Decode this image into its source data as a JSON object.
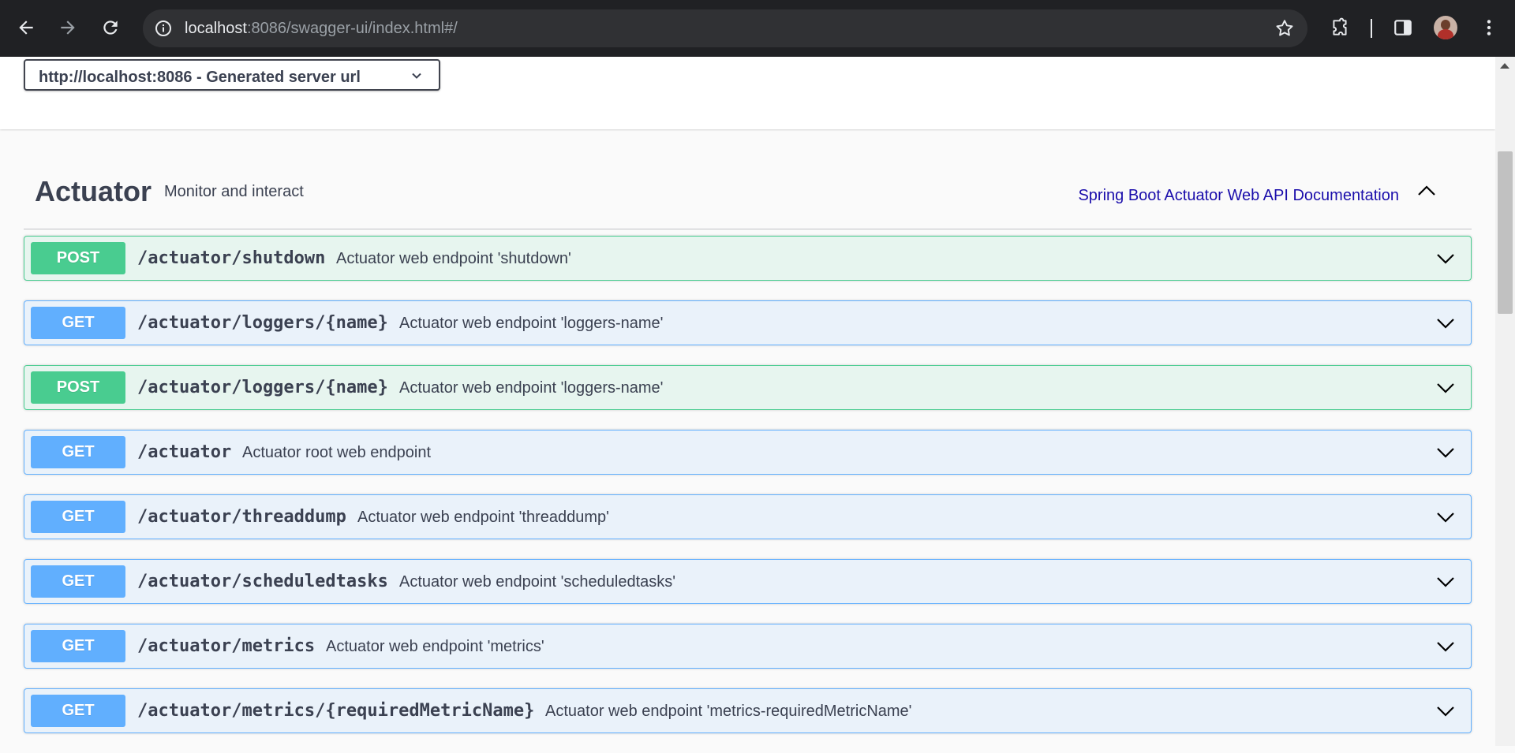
{
  "browser": {
    "url_host": "localhost",
    "url_rest": ":8086/swagger-ui/index.html#/"
  },
  "servers": {
    "selected": "http://localhost:8086 - Generated server url"
  },
  "tag": {
    "name": "Actuator",
    "description": "Monitor and interact",
    "external_doc": "Spring Boot Actuator Web API Documentation"
  },
  "operations": [
    {
      "method": "POST",
      "path": "/actuator/shutdown",
      "summary": "Actuator web endpoint 'shutdown'"
    },
    {
      "method": "GET",
      "path": "/actuator/loggers/{name}",
      "summary": "Actuator web endpoint 'loggers-name'"
    },
    {
      "method": "POST",
      "path": "/actuator/loggers/{name}",
      "summary": "Actuator web endpoint 'loggers-name'"
    },
    {
      "method": "GET",
      "path": "/actuator",
      "summary": "Actuator root web endpoint"
    },
    {
      "method": "GET",
      "path": "/actuator/threaddump",
      "summary": "Actuator web endpoint 'threaddump'"
    },
    {
      "method": "GET",
      "path": "/actuator/scheduledtasks",
      "summary": "Actuator web endpoint 'scheduledtasks'"
    },
    {
      "method": "GET",
      "path": "/actuator/metrics",
      "summary": "Actuator web endpoint 'metrics'"
    },
    {
      "method": "GET",
      "path": "/actuator/metrics/{requiredMetricName}",
      "summary": "Actuator web endpoint 'metrics-requiredMetricName'"
    }
  ],
  "colors": {
    "get": "#61affe",
    "post": "#49cc90",
    "link": "#1a0dab"
  }
}
